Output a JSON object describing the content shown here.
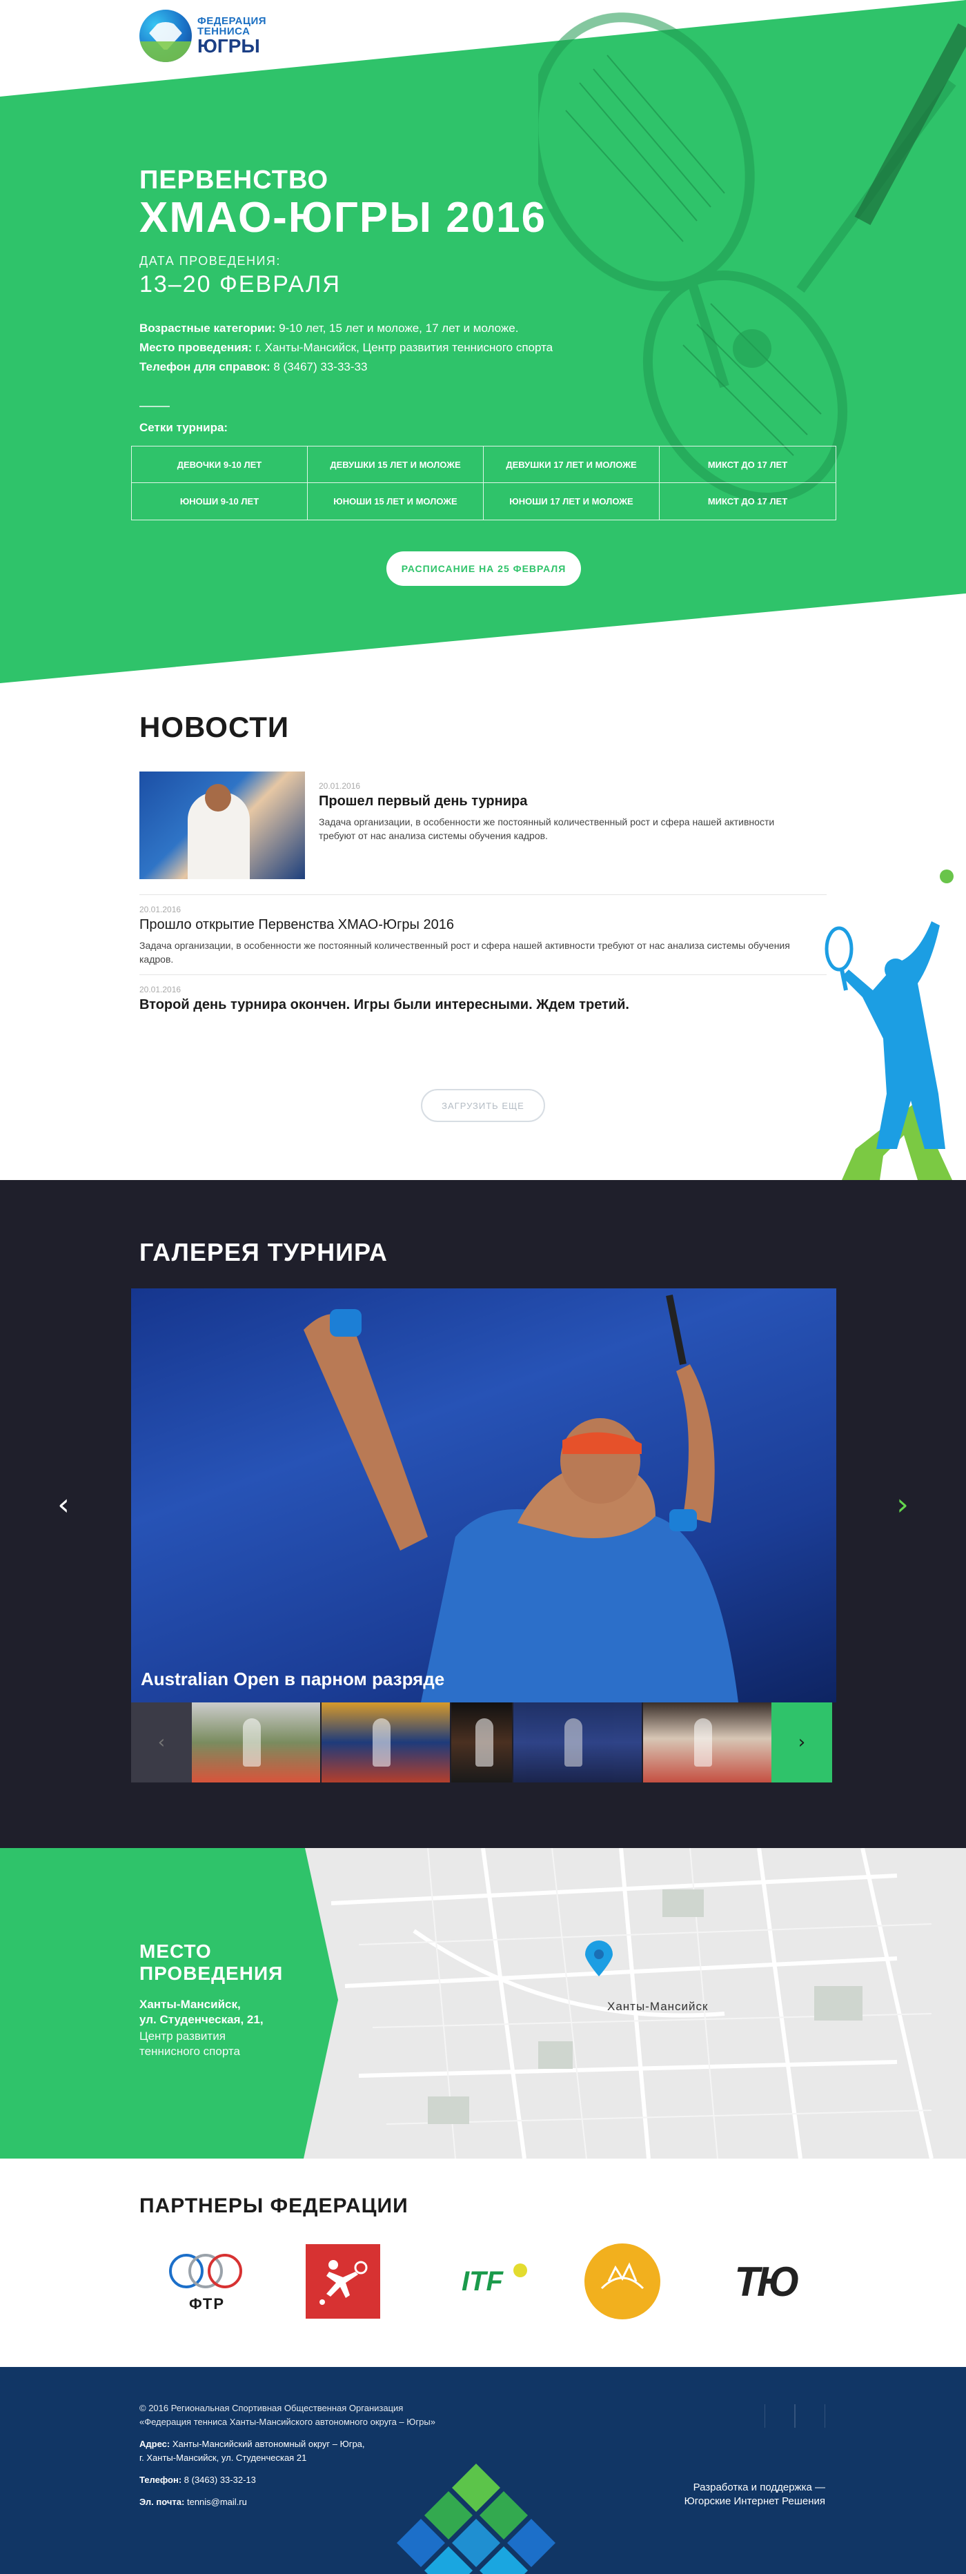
{
  "logo": {
    "line1": "ФЕДЕРАЦИЯ",
    "line2": "ТЕННИСА",
    "line3": "ЮГРЫ"
  },
  "hero": {
    "title_line1": "ПЕРВЕНСТВО",
    "title_line2": "ХМАО-ЮГРЫ 2016",
    "date_label": "ДАТА ПРОВЕДЕНИЯ:",
    "date_value": "13–20 ФЕВРАЛЯ",
    "info": [
      {
        "label": "Возрастные категории:",
        "value": " 9-10 лет, 15 лет и моложе, 17 лет и моложе."
      },
      {
        "label": "Место проведения:",
        "value": "  г. Ханты-Мансийск, Центр развития теннисного спорта"
      },
      {
        "label": "Телефон для справок:",
        "value": " 8 (3467) 33-33-33"
      }
    ],
    "grid_label": "Сетки турнира:",
    "grid_cells": [
      "ДЕВОЧКИ 9-10 ЛЕТ",
      "ДЕВУШКИ 15 ЛЕТ И МОЛОЖЕ",
      "ДЕВУШКИ 17 ЛЕТ И МОЛОЖЕ",
      "МИКСТ ДО 17 ЛЕТ",
      "ЮНОШИ 9-10 ЛЕТ",
      "ЮНОШИ 15 ЛЕТ И МОЛОЖЕ",
      "ЮНОШИ 17 ЛЕТ И МОЛОЖЕ",
      "МИКСТ ДО 17 ЛЕТ"
    ],
    "schedule_button": "РАСПИСАНИЕ НА 25 ФЕВРАЛЯ"
  },
  "news": {
    "heading": "НОВОСТИ",
    "items": [
      {
        "date": "20.01.2016",
        "title": "Прошел первый день турнира",
        "desc": "Задача организации, в особенности же постоянный количественный рост и сфера нашей активности требуют от нас анализа системы обучения кадров."
      },
      {
        "date": "20.01.2016",
        "title": "Прошло открытие Первенства ХМАО-Югры 2016",
        "desc": "Задача организации, в особенности же постоянный количественный рост и сфера нашей активности требуют от нас анализа системы обучения кадров."
      },
      {
        "date": "20.01.2016",
        "title": "Второй день турнира окончен. Игры были интересными. Ждем третий.",
        "desc": ""
      }
    ],
    "load_more": "ЗАГРУЗИТЬ ЕЩЕ"
  },
  "gallery": {
    "heading": "ГАЛЕРЕЯ ТУРНИРА",
    "caption": "Australian Open в парном разряде",
    "arrow_left": "‹",
    "arrow_right": "›",
    "thumb_prev": "‹",
    "thumb_next": "›"
  },
  "location": {
    "title": "МЕСТО ПРОВЕДЕНИЯ",
    "address_line1": "Ханты-Мансийск,",
    "address_line2": "ул. Студенческая, 21,",
    "place_line1": "Центр развития",
    "place_line2": "теннисного спорта",
    "map_city_label": "Ханты-Мансийск"
  },
  "partners": {
    "heading": "ПАРТНЕРЫ ФЕДЕРАЦИИ",
    "ftr_label": "ФТР",
    "itf_label": "ITF",
    "tu_label": "ТЮ"
  },
  "footer": {
    "copyright_line1": "© 2016 Региональная Спортивная Общественная Организация",
    "copyright_line2": "«Федерация тенниса Ханты-Мансийского автономного округа – Югры»",
    "address_label": "Адрес:",
    "address_line1": " Ханты-Мансийский автономный округ – Югра,",
    "address_line2": "г. Ханты-Мансийск, ул. Студенческая 21",
    "phone_label": "Телефон:",
    "phone_value": " 8 (3463) 33-32-13",
    "email_label": "Эл. почта:",
    "email_value": " tennis@mail.ru",
    "dev_line1": "Разработка и поддержка —",
    "dev_line2": "Югорские Интернет Решения"
  },
  "colors": {
    "brand_green": "#2fc36a",
    "dark_bg": "#1f1f2b",
    "footer_bg": "#113665",
    "accent_blue": "#1b6fc2"
  }
}
